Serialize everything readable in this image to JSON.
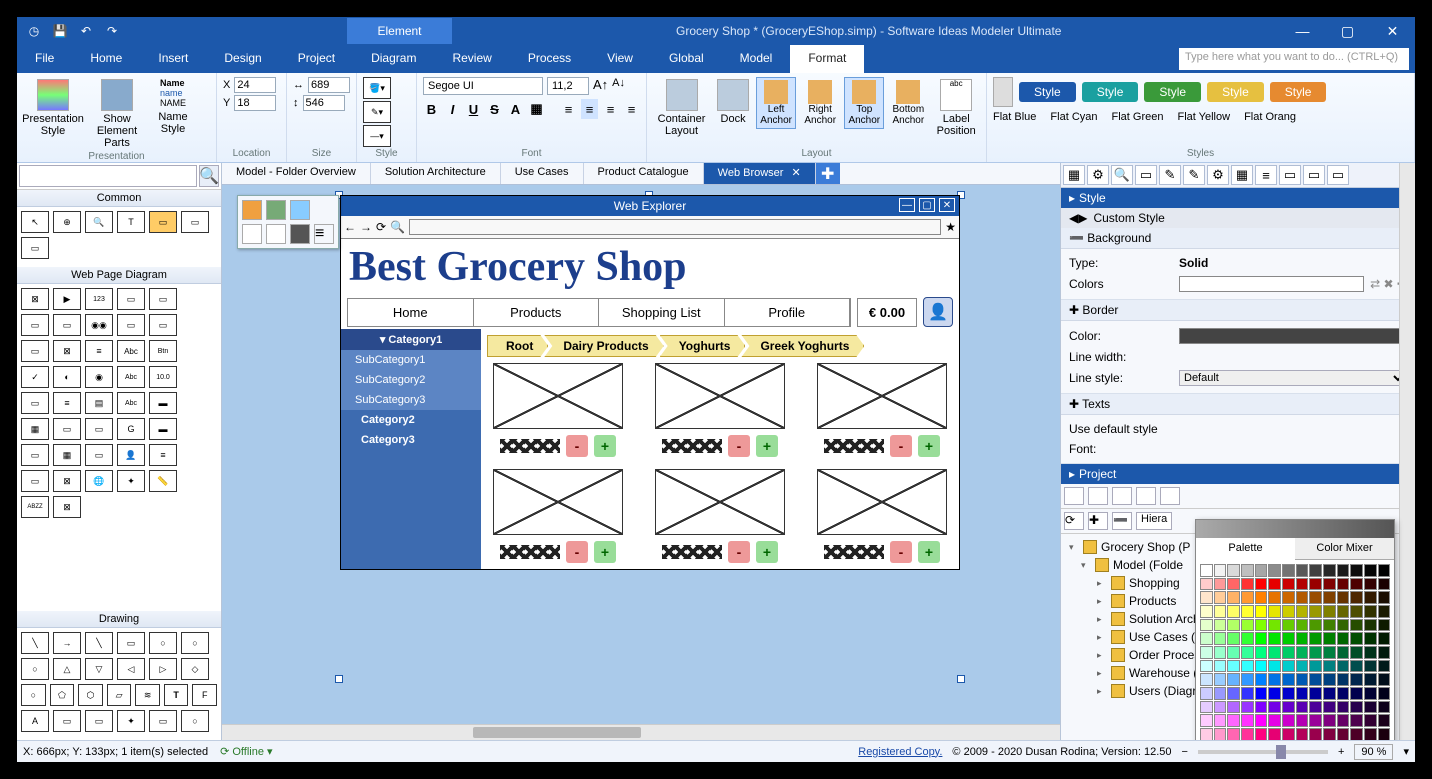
{
  "titlebar": {
    "element": "Element",
    "doc": "Grocery Shop * (GroceryEShop.simp) - Software Ideas Modeler Ultimate"
  },
  "menu": {
    "items": [
      "File",
      "Home",
      "Insert",
      "Design",
      "Project",
      "Diagram",
      "Review",
      "Process",
      "View",
      "Global",
      "Model",
      "Format"
    ],
    "active": "Format",
    "search_placeholder": "Type here what you want to do...  (CTRL+Q)"
  },
  "ribbon": {
    "presentation": {
      "label": "Presentation",
      "style": "Presentation Style",
      "show": "Show Element Parts",
      "namestyle": "Name Style"
    },
    "location": {
      "label": "Location",
      "x": "X",
      "xv": "24",
      "y": "Y",
      "yv": "18"
    },
    "size": {
      "label": "Size",
      "w": "689",
      "h": "546"
    },
    "style": {
      "label": "Style"
    },
    "font": {
      "label": "Font",
      "name": "Segoe UI",
      "size": "11,2"
    },
    "layout": {
      "label": "Layout",
      "container": "Container Layout",
      "dock": "Dock",
      "left": "Left Anchor",
      "right": "Right Anchor",
      "top": "Top Anchor",
      "bottom": "Bottom Anchor",
      "labelpos": "Label Position"
    },
    "styles": {
      "label": "Styles",
      "pill": "Style",
      "names": [
        "Flat Blue",
        "Flat Cyan",
        "Flat Green",
        "Flat Yellow",
        "Flat Orang"
      ]
    }
  },
  "left": {
    "common": "Common",
    "wpd": "Web Page Diagram",
    "drawing": "Drawing"
  },
  "doctabs": {
    "tabs": [
      "Model - Folder Overview",
      "Solution Architecture",
      "Use Cases",
      "Product Catalogue",
      "Web Browser"
    ],
    "active": "Web Browser"
  },
  "browser": {
    "title": "Web Explorer",
    "heading": "Best Grocery Shop",
    "nav": [
      "Home",
      "Products",
      "Shopping List",
      "Profile"
    ],
    "price": "€ 0.00",
    "side": {
      "h": "Category1",
      "subs": [
        "SubCategory1",
        "SubCategory2",
        "SubCategory3"
      ],
      "mains": [
        "Category2",
        "Category3"
      ]
    },
    "bc": [
      "Root",
      "Dairy Products",
      "Yoghurts",
      "Greek Yoghurts"
    ]
  },
  "rightpanel": {
    "style_title": "Style",
    "custom": "Custom Style",
    "background": "Background",
    "type_lbl": "Type:",
    "type_val": "Solid",
    "colors_lbl": "Colors",
    "border": "Border",
    "color_lbl": "Color:",
    "linew": "Line width:",
    "lines": "Line style:",
    "lines_val": "Default",
    "texts": "Texts",
    "usedef": "Use default style",
    "font_lbl": "Font:",
    "picker": {
      "palette": "Palette",
      "mixer": "Color Mixer"
    },
    "project": {
      "title": "Project",
      "hier": "Hiera",
      "tree": [
        {
          "d": 0,
          "exp": "▾",
          "t": "Grocery Shop (P"
        },
        {
          "d": 1,
          "exp": "▾",
          "t": "Model (Folde"
        },
        {
          "d": 2,
          "exp": "▸",
          "t": "Shopping"
        },
        {
          "d": 2,
          "exp": "▸",
          "t": "Products"
        },
        {
          "d": 2,
          "exp": "▸",
          "t": "Solution Architecture (Diagram)"
        },
        {
          "d": 2,
          "exp": "▸",
          "t": "Use Cases (Diagram)"
        },
        {
          "d": 2,
          "exp": "▸",
          "t": "Order Processing States (Diagram)"
        },
        {
          "d": 2,
          "exp": "▸",
          "t": "Warehouse (Diagram)"
        },
        {
          "d": 2,
          "exp": "▸",
          "t": "Users (Diagram)"
        }
      ]
    }
  },
  "status": {
    "coords": "X: 666px; Y: 133px; 1 item(s) selected",
    "offline": "Offline",
    "reg": "Registered Copy.",
    "copy": "© 2009 - 2020 Dusan Rodina; Version: 12.50",
    "zoom": "90 %"
  },
  "palette_colors": [
    "#ffffff",
    "#f2f2f2",
    "#d9d9d9",
    "#bfbfbf",
    "#a6a6a6",
    "#8c8c8c",
    "#737373",
    "#595959",
    "#404040",
    "#262626",
    "#1a1a1a",
    "#0d0d0d",
    "#050505",
    "#000000",
    "#ffcccc",
    "#ff9999",
    "#ff6666",
    "#ff3333",
    "#ff0000",
    "#e60000",
    "#cc0000",
    "#b30000",
    "#990000",
    "#800000",
    "#660000",
    "#4d0000",
    "#330000",
    "#1a0000",
    "#ffe5cc",
    "#ffcc99",
    "#ffb266",
    "#ff9933",
    "#ff8000",
    "#e67300",
    "#cc6600",
    "#b35900",
    "#994d00",
    "#804000",
    "#663300",
    "#4d2600",
    "#331a00",
    "#1a0d00",
    "#ffffcc",
    "#ffff99",
    "#ffff66",
    "#ffff33",
    "#ffff00",
    "#e6e600",
    "#cccc00",
    "#b3b300",
    "#999900",
    "#808000",
    "#666600",
    "#4d4d00",
    "#333300",
    "#1a1a00",
    "#e5ffcc",
    "#ccff99",
    "#b2ff66",
    "#99ff33",
    "#80ff00",
    "#73e600",
    "#66cc00",
    "#59b300",
    "#4d9900",
    "#408000",
    "#336600",
    "#264d00",
    "#1a3300",
    "#0d1a00",
    "#ccffcc",
    "#99ff99",
    "#66ff66",
    "#33ff33",
    "#00ff00",
    "#00e600",
    "#00cc00",
    "#00b300",
    "#009900",
    "#008000",
    "#006600",
    "#004d00",
    "#003300",
    "#001a00",
    "#ccffe5",
    "#99ffcc",
    "#66ffb2",
    "#33ff99",
    "#00ff80",
    "#00e673",
    "#00cc66",
    "#00b359",
    "#00994d",
    "#008040",
    "#006633",
    "#004d26",
    "#00331a",
    "#001a0d",
    "#ccffff",
    "#99ffff",
    "#66ffff",
    "#33ffff",
    "#00ffff",
    "#00e6e6",
    "#00cccc",
    "#00b3b3",
    "#009999",
    "#008080",
    "#006666",
    "#004d4d",
    "#003333",
    "#001a1a",
    "#cce5ff",
    "#99ccff",
    "#66b2ff",
    "#3399ff",
    "#0080ff",
    "#0073e6",
    "#0066cc",
    "#0059b3",
    "#004d99",
    "#004080",
    "#003366",
    "#00264d",
    "#001a33",
    "#000d1a",
    "#ccccff",
    "#9999ff",
    "#6666ff",
    "#3333ff",
    "#0000ff",
    "#0000e6",
    "#0000cc",
    "#0000b3",
    "#000099",
    "#000080",
    "#000066",
    "#00004d",
    "#000033",
    "#00001a",
    "#e5ccff",
    "#cc99ff",
    "#b266ff",
    "#9933ff",
    "#8000ff",
    "#7300e6",
    "#6600cc",
    "#5900b3",
    "#4d0099",
    "#400080",
    "#330066",
    "#26004d",
    "#1a0033",
    "#0d001a",
    "#ffccff",
    "#ff99ff",
    "#ff66ff",
    "#ff33ff",
    "#ff00ff",
    "#e600e6",
    "#cc00cc",
    "#b300b3",
    "#990099",
    "#800080",
    "#660066",
    "#4d004d",
    "#330033",
    "#1a001a",
    "#ffcce5",
    "#ff99cc",
    "#ff66b2",
    "#ff3399",
    "#ff0080",
    "#e60073",
    "#cc0066",
    "#b30059",
    "#99004d",
    "#800040",
    "#660033",
    "#4d0026",
    "#33001a",
    "#1a000d"
  ],
  "style_pills": [
    "#1c58ab",
    "#1aa0a0",
    "#3a9a3a",
    "#e6c040",
    "#e68a30"
  ]
}
